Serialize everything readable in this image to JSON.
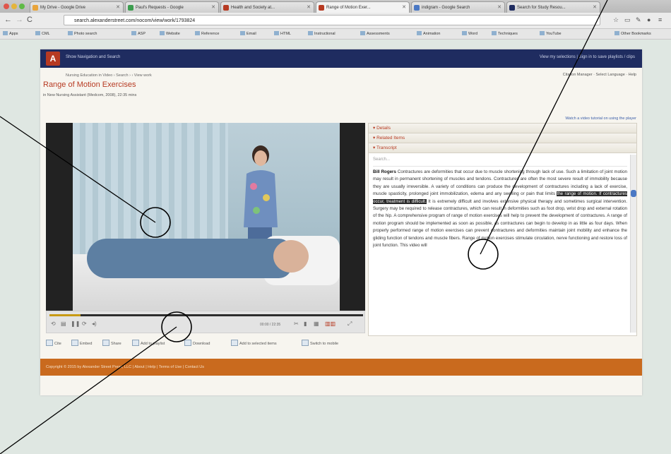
{
  "browser": {
    "tabs": [
      {
        "label": "My Drive - Google Drive",
        "color": "#e9a43a"
      },
      {
        "label": "Paul's Requests - Google",
        "color": "#3c9d4f"
      },
      {
        "label": "Health and Society at...",
        "color": "#b73a22"
      },
      {
        "label": "Range of Motion Exer...",
        "color": "#b73a22"
      },
      {
        "label": "indigram - Google Search",
        "color": "#4a78c4"
      },
      {
        "label": "Search for Study Resou...",
        "color": "#1f2c60"
      }
    ],
    "url": "search.alexanderstreet.com/nocom/view/work/1793824",
    "bookmarks": [
      "Apps",
      "CML",
      "Photo search",
      "ASP",
      "Website",
      "Reference",
      "Email",
      "HTML",
      "Instructional",
      "Assessments",
      "Animation",
      "Word",
      "Techniques",
      "YouTube",
      "Other Bookmarks"
    ]
  },
  "site": {
    "header_left": "Show Navigation and Search",
    "header_right": "View my selections | Sign in to save playlists / clips",
    "breadcrumb": "Nursing Education in Video › Search › › View work",
    "tools": "Citation Manager · Select Language · Help",
    "title": "Range of Motion Exercises",
    "subtitle": "in New Nursing Assistant (Medcom, 2008), 22:35 mins",
    "tutorial_link": "Watch a video tutorial on using the player"
  },
  "player": {
    "progress": 0.1,
    "timecode": "00:00 / 22:35",
    "accent": "#c89a14"
  },
  "actions": [
    "Cite",
    "Embed",
    "Share",
    "Add to playlist",
    "Download",
    "Add to selected items",
    "Switch to mobile"
  ],
  "panel": {
    "sections": [
      "Details",
      "Related Items",
      "Transcript"
    ],
    "search_placeholder": "Search...",
    "speaker": "Bill Rogers",
    "transcript_1": "Contractures are deformities that occur due to muscle shortening through lack of use. Such a limitation of joint motion may result in permanent shortening of muscles and tendons. Contractures are often the most severe result of immobility because they are usually irreversible. A variety of conditions can produce the development of contractures including a lack of exercise, muscle spasticity, prolonged joint immobilization, edema and any swelling or pain that limits",
    "highlight": "the range of motion. If contractures occur, treatment is difficult.",
    "transcript_2": "It is extremely difficult and involves extensive physical therapy and sometimes surgical intervention. Surgery may be required to release contractures, which can result in deformities such as foot drop, wrist drop and external rotation of the hip. A comprehensive program of range of motion exercises will help to prevent the development of contractures. A range of motion program should be implemented as soon as possible, as contractures can begin to develop in as little as four days. When properly performed range of motion exercises can prevent contractures and deformities maintain joint mobility and enhance the gliding function of tendons and muscle fibers. Range of motion exercises stimulate circulation, nerve functioning and restore loss of joint function. This video will"
  },
  "footer": "Copyright © 2015 by Alexander Street Press, LLC | About | Help | Terms of Use | Contact Us"
}
